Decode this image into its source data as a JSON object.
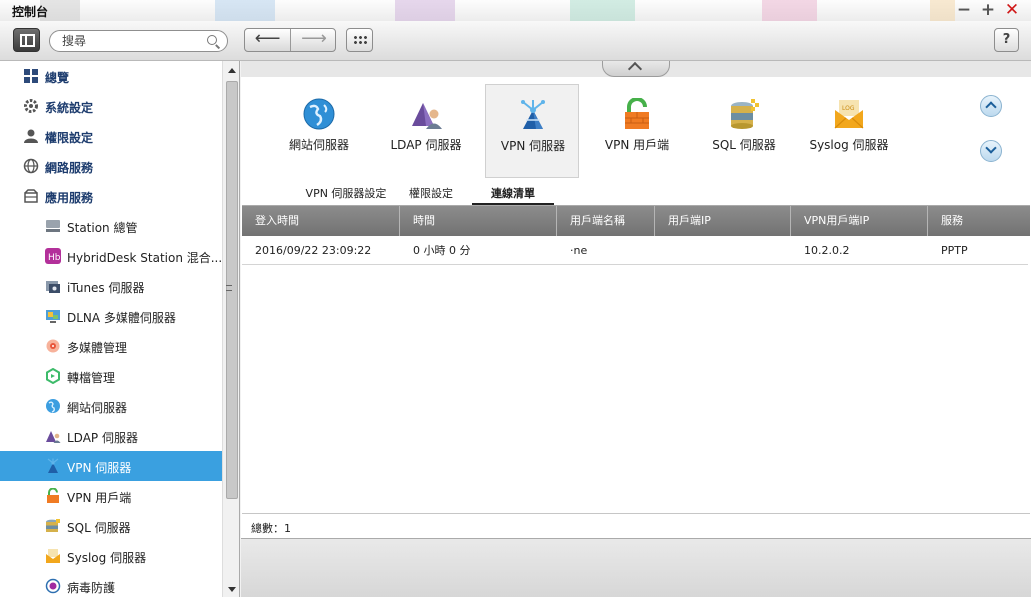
{
  "window": {
    "title": "控制台"
  },
  "toolbar": {
    "search_placeholder": "搜尋",
    "help_label": "?"
  },
  "sidebar": {
    "top_items": [
      {
        "label": "總覽",
        "icon": "grid-icon"
      },
      {
        "label": "系統設定",
        "icon": "gear-icon"
      },
      {
        "label": "權限設定",
        "icon": "user-icon"
      },
      {
        "label": "網路服務",
        "icon": "globe-icon"
      },
      {
        "label": "應用服務",
        "icon": "box-icon"
      }
    ],
    "sub_items": [
      {
        "label": "Station 總管",
        "icon": "station-icon"
      },
      {
        "label": "HybridDesk Station 混合...",
        "icon": "hybriddesk-icon"
      },
      {
        "label": "iTunes 伺服器",
        "icon": "itunes-icon"
      },
      {
        "label": "DLNA 多媒體伺服器",
        "icon": "dlna-icon"
      },
      {
        "label": "多媒體管理",
        "icon": "multimedia-icon"
      },
      {
        "label": "轉檔管理",
        "icon": "transcode-icon"
      },
      {
        "label": "網站伺服器",
        "icon": "web-server-icon"
      },
      {
        "label": "LDAP 伺服器",
        "icon": "ldap-icon"
      },
      {
        "label": "VPN 伺服器",
        "icon": "vpn-server-icon",
        "active": true
      },
      {
        "label": "VPN 用戶端",
        "icon": "vpn-client-icon"
      },
      {
        "label": "SQL 伺服器",
        "icon": "sql-icon"
      },
      {
        "label": "Syslog 伺服器",
        "icon": "syslog-icon"
      },
      {
        "label": "病毒防護",
        "icon": "antivirus-icon"
      }
    ]
  },
  "apps": [
    {
      "label": "網站伺服器",
      "icon": "web-server-icon"
    },
    {
      "label": "LDAP 伺服器",
      "icon": "ldap-icon"
    },
    {
      "label": "VPN 伺服器",
      "icon": "vpn-server-icon",
      "selected": true
    },
    {
      "label": "VPN 用戶端",
      "icon": "vpn-client-icon"
    },
    {
      "label": "SQL 伺服器",
      "icon": "sql-icon"
    },
    {
      "label": "Syslog 伺服器",
      "icon": "syslog-icon"
    }
  ],
  "tabs": [
    {
      "label": "VPN 伺服器設定"
    },
    {
      "label": "權限設定"
    },
    {
      "label": "連線清單",
      "active": true
    }
  ],
  "grid": {
    "columns": [
      "登入時間",
      "時間",
      "用戶端名稱",
      "用戶端IP",
      "VPN用戶端IP",
      "服務"
    ],
    "rows": [
      [
        "2016/09/22 23:09:22",
        "0 小時 0 分",
        "·ne",
        "",
        "10.2.0.2",
        "PPTP"
      ]
    ],
    "footer_total": "總數：1"
  },
  "colors": {
    "accent": "#3aa0e0",
    "header": "#7e7e7e",
    "close": "#d01818"
  }
}
